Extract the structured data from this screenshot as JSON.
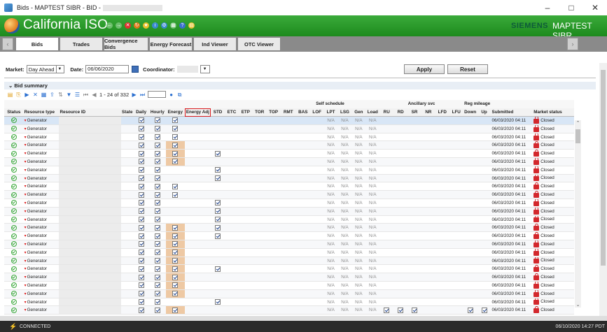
{
  "window": {
    "title": "Bids - MAPTEST SIBR - BID -",
    "controls": [
      "–",
      "□",
      "✕"
    ]
  },
  "banner": {
    "logo": "California ISO",
    "vendor": "SIEMENS",
    "environment": "MAPTEST SIBR"
  },
  "tabs": [
    "Bids",
    "Trades",
    "Convergence Bids",
    "Energy Forecast",
    "Ind Viewer",
    "OTC Viewer"
  ],
  "active_tab": "Bids",
  "filters": {
    "market_label": "Market:",
    "market_value": "Day Ahead",
    "date_label": "Date:",
    "date_value": "06/06/2020",
    "coordinator_label": "Coordinator:",
    "apply_label": "Apply",
    "reset_label": "Reset"
  },
  "panel": {
    "title": "Bid summary",
    "pager": "1 - 24 of 332"
  },
  "grid": {
    "group_headers": {
      "self_schedule": "Self schedule",
      "ancillary": "Ancillary svc",
      "reg_mileage": "Reg mileage"
    },
    "columns": [
      "Status",
      "Resource type",
      "Resource ID",
      "State",
      "Daily",
      "Hourly",
      "Energy",
      "Energy Adj",
      "STD",
      "ETC",
      "ETP",
      "TOR",
      "TOP",
      "RMT",
      "BAS",
      "LOF",
      "LPT",
      "LSG",
      "Gen",
      "Load",
      "RU",
      "RD",
      "SR",
      "NR",
      "LFD",
      "LFU",
      "Down",
      "Up",
      "Submitted",
      "Market status"
    ],
    "highlighted_column": "Energy Adj",
    "na_text": "N/A",
    "resource_type": "Generator",
    "submitted": "06/03/2020 04:11",
    "market_status": "Closed",
    "rows": [
      {
        "energy": true,
        "energy_hl": false,
        "std": false,
        "reg": false
      },
      {
        "energy": true,
        "energy_hl": false,
        "std": false,
        "reg": false
      },
      {
        "energy": true,
        "energy_hl": false,
        "std": false,
        "reg": false
      },
      {
        "energy": true,
        "energy_hl": true,
        "std": false,
        "reg": false
      },
      {
        "energy": true,
        "energy_hl": true,
        "std": true,
        "reg": false
      },
      {
        "energy": true,
        "energy_hl": true,
        "std": false,
        "reg": false
      },
      {
        "energy": false,
        "energy_hl": false,
        "std": true,
        "reg": false
      },
      {
        "energy": false,
        "energy_hl": false,
        "std": true,
        "reg": false
      },
      {
        "energy": true,
        "energy_hl": false,
        "std": false,
        "reg": false
      },
      {
        "energy": true,
        "energy_hl": false,
        "std": false,
        "reg": false
      },
      {
        "energy": false,
        "energy_hl": false,
        "std": true,
        "reg": false
      },
      {
        "energy": false,
        "energy_hl": false,
        "std": true,
        "reg": false
      },
      {
        "energy": false,
        "energy_hl": false,
        "std": true,
        "reg": false
      },
      {
        "energy": true,
        "energy_hl": true,
        "std": true,
        "reg": false
      },
      {
        "energy": true,
        "energy_hl": true,
        "std": true,
        "reg": false
      },
      {
        "energy": true,
        "energy_hl": true,
        "std": false,
        "reg": false
      },
      {
        "energy": true,
        "energy_hl": true,
        "std": false,
        "reg": false
      },
      {
        "energy": true,
        "energy_hl": true,
        "std": false,
        "reg": false
      },
      {
        "energy": true,
        "energy_hl": true,
        "std": true,
        "reg": false
      },
      {
        "energy": true,
        "energy_hl": true,
        "std": false,
        "reg": false
      },
      {
        "energy": true,
        "energy_hl": true,
        "std": false,
        "reg": false
      },
      {
        "energy": true,
        "energy_hl": true,
        "std": false,
        "reg": false
      },
      {
        "energy": false,
        "energy_hl": false,
        "std": true,
        "reg": false
      },
      {
        "energy": true,
        "energy_hl": true,
        "std": false,
        "reg": true
      }
    ]
  },
  "status": {
    "connection": "CONNECTED",
    "timestamp": "06/10/2020 14:27 PDT"
  },
  "colors": {
    "banner_green": "#2a9a2a",
    "energy_highlight": "#eec9a4",
    "annotation_red": "#d8191c",
    "lock_red": "#d3282d"
  }
}
